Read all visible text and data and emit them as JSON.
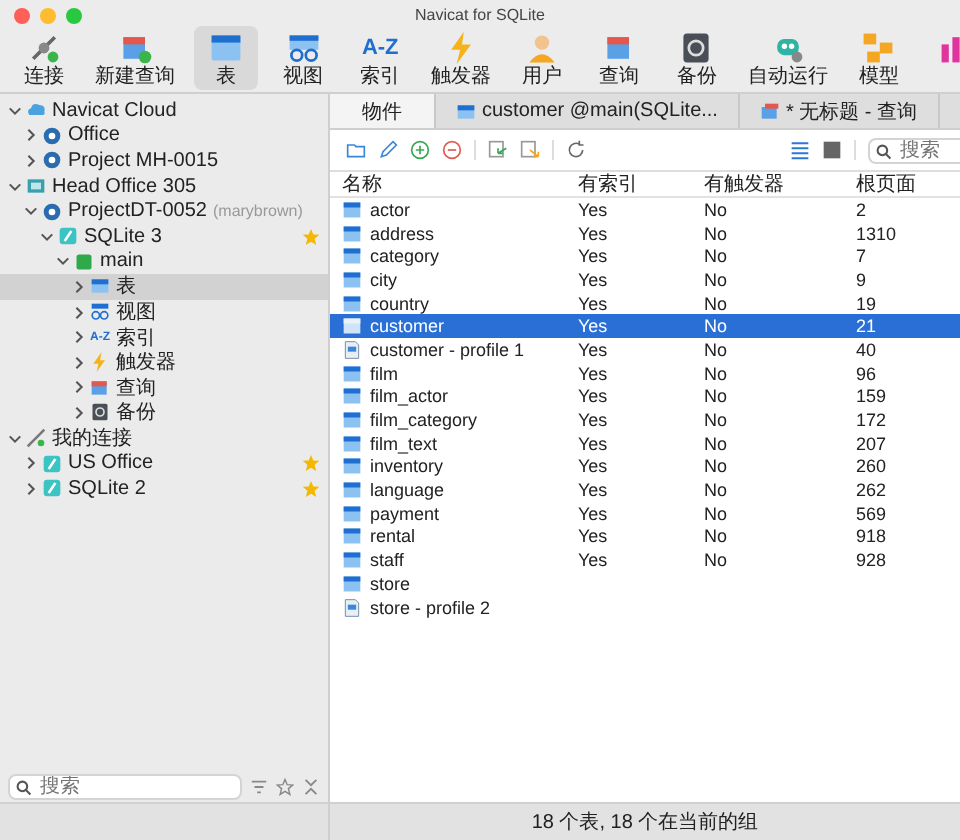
{
  "window": {
    "title": "Navicat for SQLite"
  },
  "toolbar": [
    {
      "label": "连接",
      "kind": "connect",
      "selected": false
    },
    {
      "label": "新建查询",
      "kind": "newquery",
      "selected": false
    },
    {
      "label": "表",
      "kind": "table",
      "selected": true
    },
    {
      "label": "视图",
      "kind": "view",
      "selected": false
    },
    {
      "label": "索引",
      "kind": "index",
      "icon_text": "A-Z",
      "selected": false
    },
    {
      "label": "触发器",
      "kind": "trigger",
      "selected": false
    },
    {
      "label": "用户",
      "kind": "user",
      "selected": false
    },
    {
      "label": "查询",
      "kind": "query",
      "selected": false
    },
    {
      "label": "备份",
      "kind": "backup",
      "selected": false
    },
    {
      "label": "自动运行",
      "kind": "robot",
      "selected": false
    },
    {
      "label": "模型",
      "kind": "model",
      "selected": false
    },
    {
      "kind": "chart",
      "selected": false
    }
  ],
  "sidebar": {
    "tree": [
      {
        "label": "Navicat Cloud",
        "kind": "cloud",
        "expanded": true,
        "selected": false,
        "starred": false,
        "children": [
          {
            "label": "Office",
            "kind": "project",
            "expanded": false,
            "selected": false,
            "starred": false
          },
          {
            "label": "Project MH-0015",
            "kind": "project",
            "expanded": false,
            "selected": false,
            "starred": false
          }
        ]
      },
      {
        "label": "Head Office 305",
        "kind": "server",
        "expanded": true,
        "selected": false,
        "starred": false,
        "children": [
          {
            "label": "ProjectDT-0052",
            "owner": "(marybrown)",
            "kind": "project",
            "expanded": true,
            "selected": false,
            "starred": false,
            "children": [
              {
                "label": "SQLite 3",
                "kind": "sqlite",
                "expanded": true,
                "selected": false,
                "starred": true,
                "children": [
                  {
                    "label": "main",
                    "kind": "db",
                    "expanded": true,
                    "selected": false,
                    "starred": false,
                    "children": [
                      {
                        "label": "表",
                        "kind": "table",
                        "expanded": false,
                        "selected": true,
                        "starred": false
                      },
                      {
                        "label": "视图",
                        "kind": "view",
                        "expanded": false,
                        "selected": false,
                        "starred": false
                      },
                      {
                        "label": "索引",
                        "kind": "index",
                        "icon_text": "A-Z",
                        "expanded": false,
                        "selected": false,
                        "starred": false
                      },
                      {
                        "label": "触发器",
                        "kind": "trigger",
                        "expanded": false,
                        "selected": false,
                        "starred": false
                      },
                      {
                        "label": "查询",
                        "kind": "query",
                        "expanded": false,
                        "selected": false,
                        "starred": false
                      },
                      {
                        "label": "备份",
                        "kind": "backup",
                        "expanded": false,
                        "selected": false,
                        "starred": false
                      }
                    ]
                  }
                ]
              }
            ]
          }
        ]
      },
      {
        "label": "我的连接",
        "kind": "connect",
        "expanded": true,
        "selected": false,
        "starred": false,
        "children": [
          {
            "label": "US Office",
            "kind": "sqlite",
            "expanded": false,
            "selected": false,
            "starred": true
          },
          {
            "label": "SQLite 2",
            "kind": "sqlite",
            "expanded": false,
            "selected": false,
            "starred": true
          }
        ]
      }
    ],
    "search": {
      "placeholder": "搜索"
    }
  },
  "tabs": [
    {
      "label": "物件",
      "selected": true
    },
    {
      "label": "customer @main(SQLite...",
      "kind": "table",
      "selected": false
    },
    {
      "label": "* 无标题 - 查询",
      "kind": "query",
      "selected": false
    }
  ],
  "object_toolbar": {
    "view_mode": [
      {
        "kind": "list",
        "selected": true
      },
      {
        "kind": "grid",
        "selected": false
      }
    ],
    "search": {
      "placeholder": "搜索"
    }
  },
  "table": {
    "columns": [
      "名称",
      "有索引",
      "有触发器",
      "根页面"
    ],
    "rows": [
      {
        "kind": "table",
        "name": "actor",
        "index": "Yes",
        "trigger": "No",
        "root": "2",
        "selected": false
      },
      {
        "kind": "table",
        "name": "address",
        "index": "Yes",
        "trigger": "No",
        "root": "1310",
        "selected": false
      },
      {
        "kind": "table",
        "name": "category",
        "index": "Yes",
        "trigger": "No",
        "root": "7",
        "selected": false
      },
      {
        "kind": "table",
        "name": "city",
        "index": "Yes",
        "trigger": "No",
        "root": "9",
        "selected": false
      },
      {
        "kind": "table",
        "name": "country",
        "index": "Yes",
        "trigger": "No",
        "root": "19",
        "selected": false
      },
      {
        "kind": "table",
        "name": "customer",
        "index": "Yes",
        "trigger": "No",
        "root": "21",
        "selected": true
      },
      {
        "kind": "profile",
        "name": "customer - profile 1",
        "index": "Yes",
        "trigger": "No",
        "root": "40",
        "selected": false
      },
      {
        "kind": "table",
        "name": "film",
        "index": "Yes",
        "trigger": "No",
        "root": "96",
        "selected": false
      },
      {
        "kind": "table",
        "name": "film_actor",
        "index": "Yes",
        "trigger": "No",
        "root": "159",
        "selected": false
      },
      {
        "kind": "table",
        "name": "film_category",
        "index": "Yes",
        "trigger": "No",
        "root": "172",
        "selected": false
      },
      {
        "kind": "table",
        "name": "film_text",
        "index": "Yes",
        "trigger": "No",
        "root": "207",
        "selected": false
      },
      {
        "kind": "table",
        "name": "inventory",
        "index": "Yes",
        "trigger": "No",
        "root": "260",
        "selected": false
      },
      {
        "kind": "table",
        "name": "language",
        "index": "Yes",
        "trigger": "No",
        "root": "262",
        "selected": false
      },
      {
        "kind": "table",
        "name": "payment",
        "index": "Yes",
        "trigger": "No",
        "root": "569",
        "selected": false
      },
      {
        "kind": "table",
        "name": "rental",
        "index": "Yes",
        "trigger": "No",
        "root": "918",
        "selected": false
      },
      {
        "kind": "table",
        "name": "staff",
        "index": "Yes",
        "trigger": "No",
        "root": "928",
        "selected": false
      },
      {
        "kind": "table",
        "name": "store",
        "selected": false
      },
      {
        "kind": "profile",
        "name": "store - profile 2",
        "selected": false
      }
    ]
  },
  "status_bar": "18 个表, 18 个在当前的组"
}
